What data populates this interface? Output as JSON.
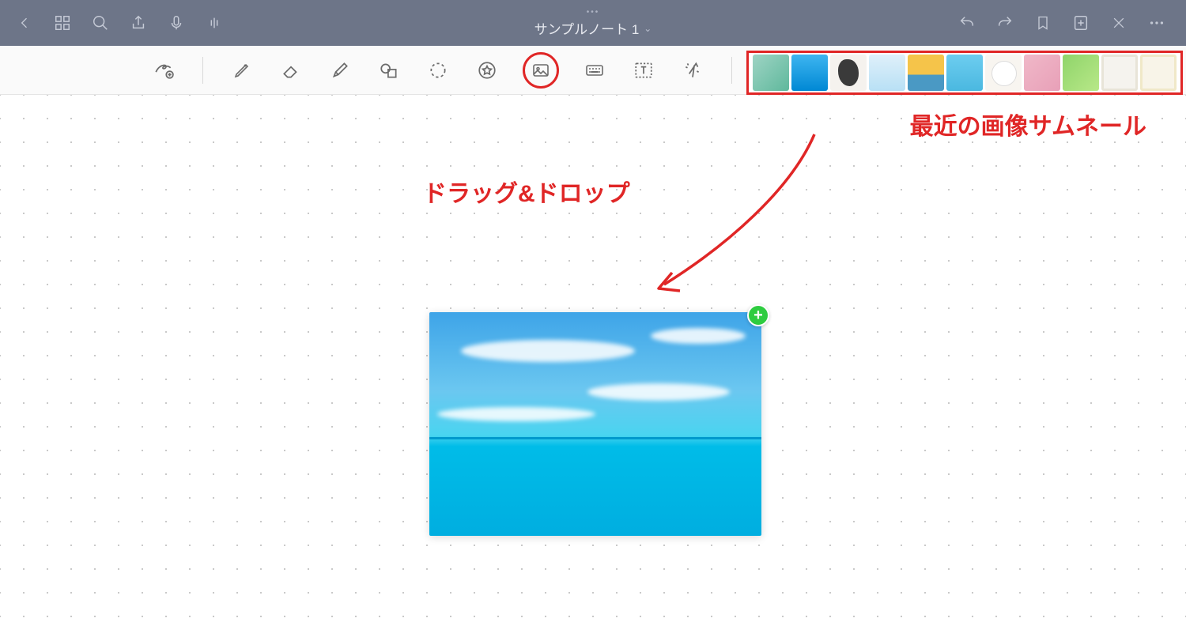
{
  "titlebar": {
    "title": "サンプルノート 1"
  },
  "annotations": {
    "drag_drop": "ドラッグ&ドロップ",
    "recent_thumbs": "最近の画像サムネール"
  },
  "toolbar": {
    "tools": [
      "zoom-draw",
      "pen",
      "eraser",
      "highlighter",
      "shapes",
      "lasso",
      "favorites",
      "image",
      "keyboard",
      "text",
      "pointer"
    ],
    "active_tool": "image"
  },
  "recent_thumbnails": {
    "count": 11
  },
  "canvas": {
    "dropped_image": "ocean-sky"
  }
}
